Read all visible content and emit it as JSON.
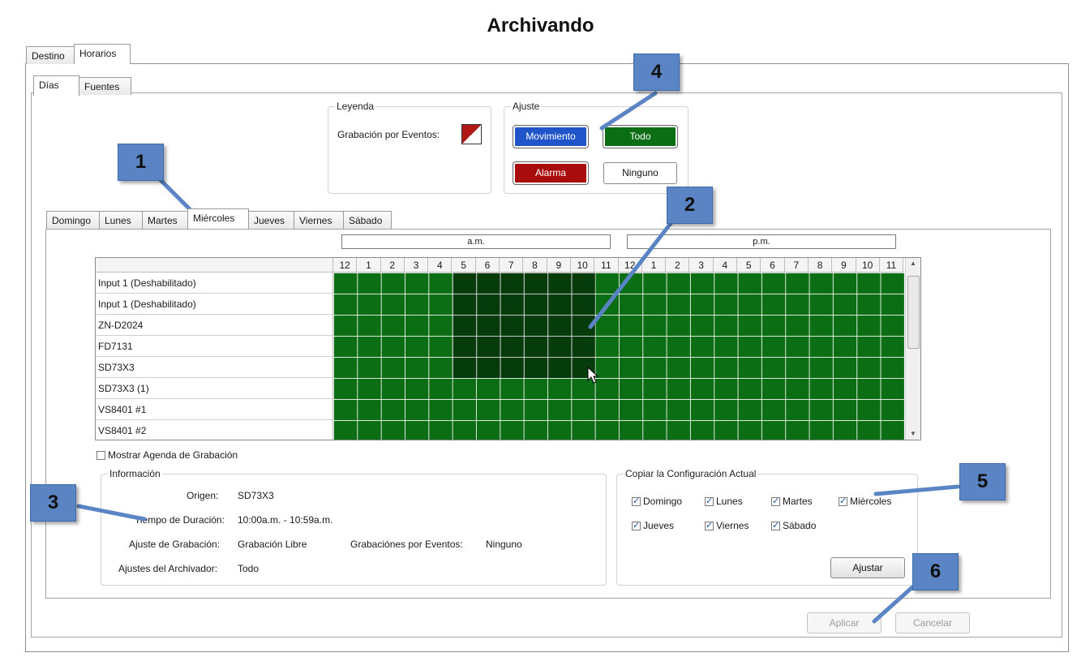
{
  "window": {
    "title": "Archivando"
  },
  "main_tabs": [
    "Destino",
    "Horarios"
  ],
  "sub_tabs": [
    "Días",
    "Fuentes"
  ],
  "legend": {
    "title": "Leyenda",
    "event_label": "Grabación por Eventos:"
  },
  "ajuste": {
    "title": "Ajuste",
    "buttons": {
      "movimiento": "Movimiento",
      "todo": "Todo",
      "alarma": "Alarma",
      "ninguno": "Ninguno"
    }
  },
  "day_tabs": [
    "Domingo",
    "Lunes",
    "Martes",
    "Miércoles",
    "Jueves",
    "Viernes",
    "Sábado"
  ],
  "active_day": "Miércoles",
  "schedule": {
    "am_label": "a.m.",
    "pm_label": "p.m.",
    "hours": [
      "12",
      "1",
      "2",
      "3",
      "4",
      "5",
      "6",
      "7",
      "8",
      "9",
      "10",
      "11",
      "12",
      "1",
      "2",
      "3",
      "4",
      "5",
      "6",
      "7",
      "8",
      "9",
      "10",
      "11"
    ],
    "sources": [
      "Input 1 (Deshabilitado)",
      "Input 1 (Deshabilitado)",
      "ZN-D2024",
      "FD7131",
      "SD73X3",
      "SD73X3 (1)",
      "VS8401 #1",
      "VS8401 #2"
    ],
    "colors": {
      "todo": "#0b6e14",
      "movimiento": "#1f55c9",
      "alarma": "#a80c0c"
    }
  },
  "show_schedule_label": "Mostrar Agenda de Grabación",
  "info": {
    "title": "Información",
    "origen_label": "Origen:",
    "origen_value": "SD73X3",
    "duracion_label": "Tiempo de Duración:",
    "duracion_value": "10:00a.m. - 10:59a.m.",
    "ajuste_label": "Ajuste de Grabación:",
    "ajuste_value": "Grabación Libre",
    "eventos_label": "Grabaciónes por Eventos:",
    "eventos_value": "Ninguno",
    "archivador_label": "Ajustes del Archivador:",
    "archivador_value": "Todo"
  },
  "copy": {
    "title": "Copiar la Configuración Actual",
    "days": [
      "Domingo",
      "Lunes",
      "Martes",
      "Miércoles",
      "Jueves",
      "Viernes",
      "Sábado"
    ],
    "apply_label": "Ajustar"
  },
  "footer": {
    "apply": "Aplicar",
    "cancel": "Cancelar"
  },
  "callouts": [
    "1",
    "2",
    "3",
    "4",
    "5",
    "6"
  ]
}
